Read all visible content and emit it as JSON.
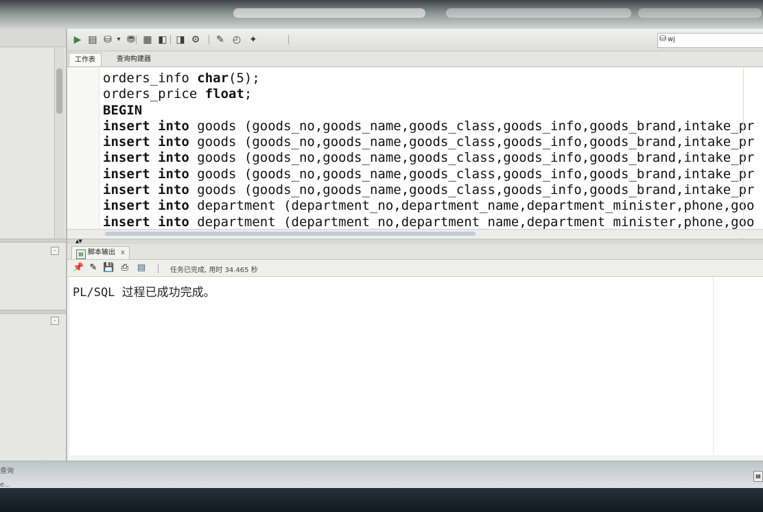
{
  "toolbar": {
    "connection": "wj",
    "buttons": [
      {
        "name": "run-icon",
        "glyph": "▶"
      },
      {
        "name": "run-script-icon",
        "glyph": "▤"
      },
      {
        "name": "commit-icon",
        "glyph": "⛁"
      },
      {
        "name": "dropdown-arrow-icon",
        "glyph": "▾"
      },
      {
        "name": "rollback-icon",
        "glyph": "⛃"
      },
      {
        "name": "explain-plan-icon",
        "glyph": "▦"
      },
      {
        "name": "autotrace-icon",
        "glyph": "◧"
      },
      {
        "name": "sql-tuning-icon",
        "glyph": "◨"
      },
      {
        "name": "unshared-sql-icon",
        "glyph": "⚙"
      },
      {
        "name": "clear-icon",
        "glyph": "✎"
      },
      {
        "name": "history-icon",
        "glyph": "◴"
      },
      {
        "name": "format-icon",
        "glyph": "✦"
      }
    ]
  },
  "tabs": [
    {
      "label": "工作表"
    },
    {
      "label": "查询构建器"
    }
  ],
  "editor": {
    "lines": [
      {
        "kw": "",
        "text": "orders_info ",
        "kw2": "char",
        "rest": "(5);"
      },
      {
        "kw": "",
        "text": "orders_price ",
        "kw2": "float",
        "rest": ";"
      },
      {
        "kw": "BEGIN",
        "text": "",
        "kw2": "",
        "rest": ""
      },
      {
        "kw": "insert into",
        "text": " goods (goods_no,goods_name,goods_class,goods_info,goods_brand,intake_pr",
        "kw2": "",
        "rest": ""
      },
      {
        "kw": "insert into",
        "text": " goods (goods_no,goods_name,goods_class,goods_info,goods_brand,intake_pr",
        "kw2": "",
        "rest": ""
      },
      {
        "kw": "insert into",
        "text": " goods (goods_no,goods_name,goods_class,goods_info,goods_brand,intake_pr",
        "kw2": "",
        "rest": ""
      },
      {
        "kw": "insert into",
        "text": " goods (goods_no,goods_name,goods_class,goods_info,goods_brand,intake_pr",
        "kw2": "",
        "rest": ""
      },
      {
        "kw": "insert into",
        "text": " goods (goods_no,goods_name,goods_class,goods_info,goods_brand,intake_pr",
        "kw2": "",
        "rest": ""
      },
      {
        "kw": "insert into",
        "text": " department (department_no,department_name,department_minister,phone,goo",
        "kw2": "",
        "rest": ""
      },
      {
        "kw": "insert into",
        "text": " department (department_no,department_name,department_minister,phone,goo",
        "kw2": "",
        "rest": ""
      }
    ]
  },
  "output": {
    "tab_label": "脚本输出",
    "tab_close": "x",
    "status": "任务已完成, 用时 34.465 秒",
    "message": "PL/SQL 过程已成功完成。",
    "buttons": [
      {
        "name": "pin-icon",
        "glyph": "📌"
      },
      {
        "name": "clear-output-icon",
        "glyph": "✎"
      },
      {
        "name": "save-icon",
        "glyph": "💾"
      },
      {
        "name": "print-icon",
        "glyph": "⎙"
      },
      {
        "name": "open-file-icon",
        "glyph": "▤"
      }
    ]
  },
  "statusbar": {
    "left_label": "查询",
    "left_label2": "e..."
  },
  "colors": {
    "accent_run": "#2e8b3a",
    "editor_bg": "#ffffff"
  }
}
